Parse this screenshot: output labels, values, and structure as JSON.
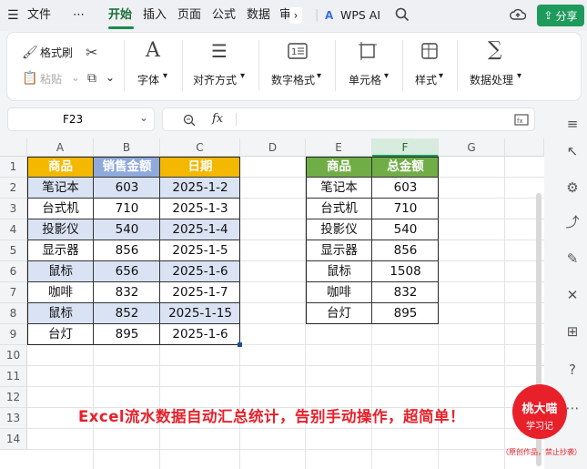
{
  "menubar": {
    "file": "文件",
    "more": "⋯",
    "tabs": [
      "开始",
      "插入",
      "页面",
      "公式",
      "数据",
      "审"
    ],
    "ai": "WPS AI",
    "share": "分享"
  },
  "ribbon": {
    "format_painter": "格式刷",
    "paste": "粘贴",
    "font": "字体",
    "align": "对齐方式",
    "number": "数字格式",
    "cell": "单元格",
    "style": "样式",
    "data": "数据处理"
  },
  "formula_bar": {
    "cell_ref": "F23",
    "fx": "fx",
    "value": ""
  },
  "columns": [
    "A",
    "B",
    "C",
    "D",
    "E",
    "F",
    "G"
  ],
  "rows": [
    "1",
    "2",
    "3",
    "4",
    "5",
    "6",
    "7",
    "8",
    "9",
    "10",
    "11",
    "12",
    "13",
    "14"
  ],
  "table1": {
    "headers": [
      "商品",
      "销售金额",
      "日期"
    ],
    "rows": [
      [
        "笔记本",
        "603",
        "2025-1-2"
      ],
      [
        "台式机",
        "710",
        "2025-1-3"
      ],
      [
        "投影仪",
        "540",
        "2025-1-4"
      ],
      [
        "显示器",
        "856",
        "2025-1-5"
      ],
      [
        "鼠标",
        "656",
        "2025-1-6"
      ],
      [
        "咖啡",
        "832",
        "2025-1-7"
      ],
      [
        "鼠标",
        "852",
        "2025-1-15"
      ],
      [
        "台灯",
        "895",
        "2025-1-6"
      ]
    ]
  },
  "table2": {
    "headers": [
      "商品",
      "总金额"
    ],
    "rows": [
      [
        "笔记本",
        "603"
      ],
      [
        "台式机",
        "710"
      ],
      [
        "投影仪",
        "540"
      ],
      [
        "显示器",
        "856"
      ],
      [
        "鼠标",
        "1508"
      ],
      [
        "咖啡",
        "832"
      ],
      [
        "台灯",
        "895"
      ]
    ]
  },
  "caption": "Excel流水数据自动汇总统计，告别手动操作，超简单！",
  "badge": {
    "name": "桃大喵",
    "sub": "学习记",
    "note": "（原创作品，禁止抄袭）"
  },
  "colors": {
    "header_yellow": "#f5b800",
    "header_blue": "#8ea9db",
    "band_blue": "#dae3f3",
    "header_green": "#70ad47",
    "accent": "#1e9b5c",
    "caption_red": "#e8202a"
  }
}
